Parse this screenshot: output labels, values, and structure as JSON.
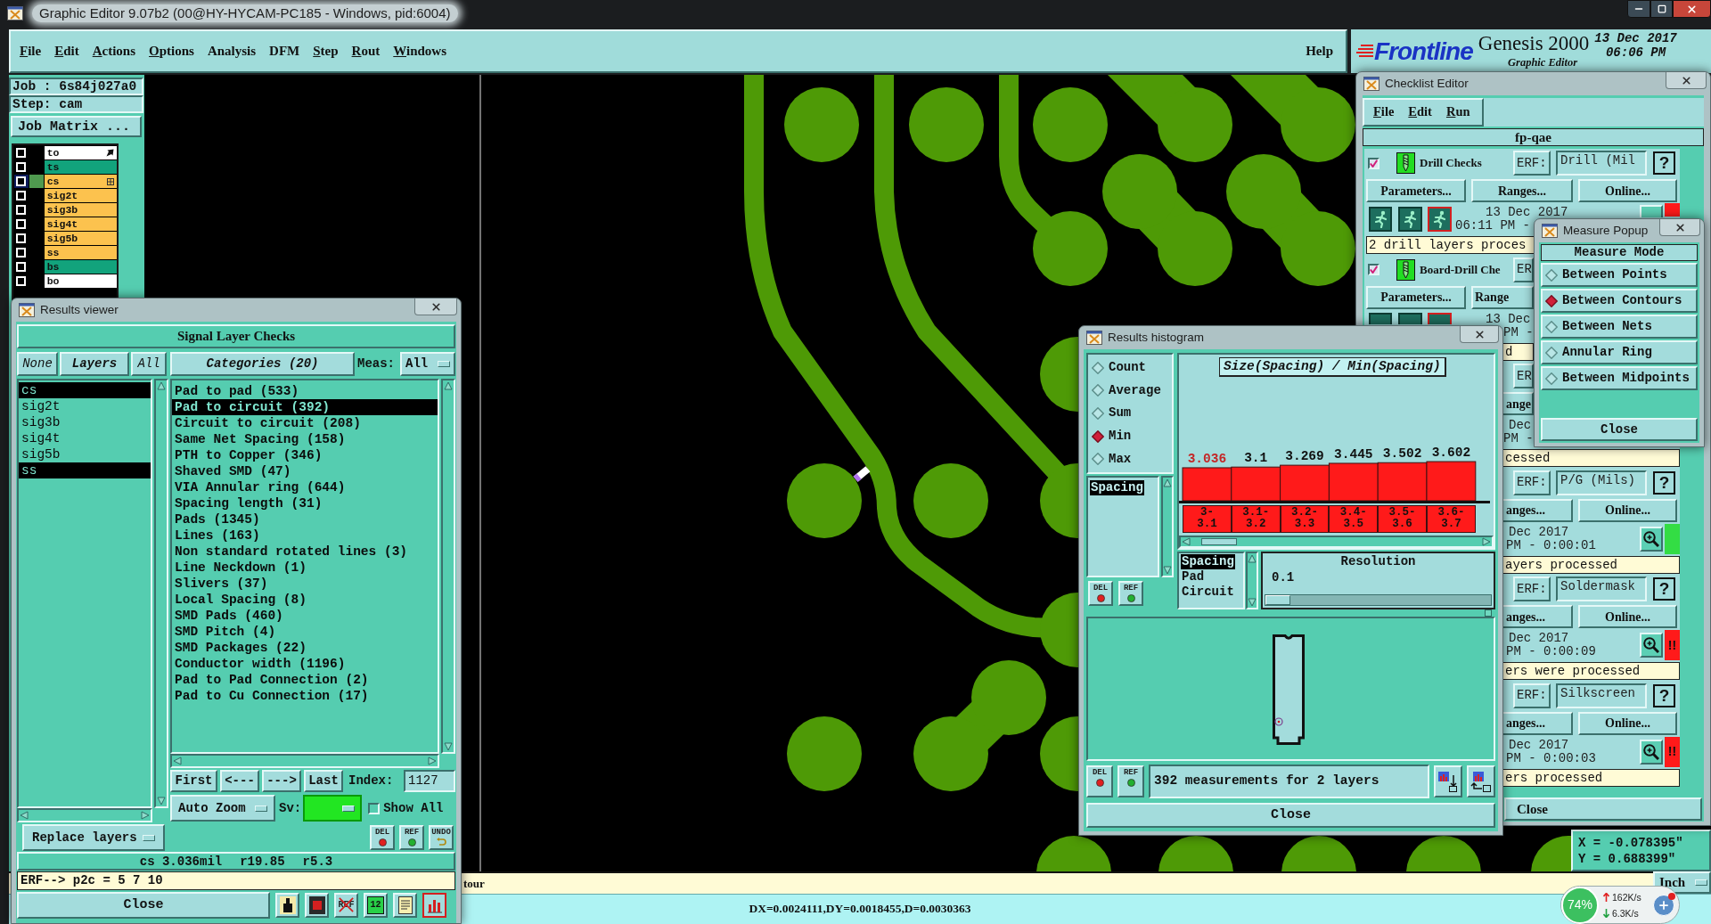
{
  "window": {
    "title": "Graphic Editor 9.07b2 (00@HY-HYCAM-PC185 - Windows, pid:6004)"
  },
  "menu": [
    {
      "label": "File",
      "mnemonic": true
    },
    {
      "label": "Edit",
      "mnemonic": true
    },
    {
      "label": "Actions",
      "mnemonic": true
    },
    {
      "label": "Options",
      "mnemonic": true
    },
    {
      "label": "Analysis",
      "mnemonic": false
    },
    {
      "label": "DFM",
      "mnemonic": false
    },
    {
      "label": "Step",
      "mnemonic": true
    },
    {
      "label": "Rout",
      "mnemonic": true
    },
    {
      "label": "Windows",
      "mnemonic": true
    }
  ],
  "help_menu": {
    "label": "Help",
    "mnemonic": false
  },
  "branding": {
    "logo": "Frontline",
    "product": "Genesis 2000",
    "subtitle": "Graphic Editor",
    "date": "13 Dec 2017",
    "time": "06:06 PM"
  },
  "job_panel": {
    "job": "Job : 6s84j027a0",
    "step": "Step: cam",
    "matrix_button": "Job Matrix ...",
    "layers": [
      {
        "name": "to",
        "color": "#ffffff",
        "checked": false,
        "selected": false,
        "kind": "pointer"
      },
      {
        "name": "ts",
        "color": "#12a37c",
        "checked": false,
        "selected": false,
        "kind": "plain"
      },
      {
        "name": "cs",
        "color": "#fcc24e",
        "checked": false,
        "selected": true,
        "kind": "grid"
      },
      {
        "name": "sig2t",
        "color": "#fcc24e",
        "checked": false,
        "selected": false,
        "kind": "plain"
      },
      {
        "name": "sig3b",
        "color": "#fcc24e",
        "checked": false,
        "selected": false,
        "kind": "plain"
      },
      {
        "name": "sig4t",
        "color": "#fcc24e",
        "checked": false,
        "selected": false,
        "kind": "plain"
      },
      {
        "name": "sig5b",
        "color": "#fcc24e",
        "checked": false,
        "selected": false,
        "kind": "plain"
      },
      {
        "name": "ss",
        "color": "#fcc24e",
        "checked": false,
        "selected": false,
        "kind": "plain"
      },
      {
        "name": "bs",
        "color": "#12a37c",
        "checked": false,
        "selected": false,
        "kind": "plain"
      },
      {
        "name": "bo",
        "color": "#ffffff",
        "checked": false,
        "selected": false,
        "kind": "plain"
      }
    ]
  },
  "cursor": {
    "x": "X = -0.078395\"",
    "y": "Y = 0.688399\""
  },
  "status_bar": {
    "message": "tour",
    "units": "Inch",
    "delta": "DX=0.0024111,DY=0.0018455,D=0.0030363"
  },
  "results_viewer": {
    "title": "Results viewer",
    "heading": "Signal Layer Checks",
    "layer_buttons": [
      {
        "label": "None",
        "bold": false
      },
      {
        "label": "Layers",
        "bold": true
      },
      {
        "label": "All",
        "bold": false
      }
    ],
    "categories_button": "Categories (20)",
    "meas_label": "Meas:",
    "meas_value": "All",
    "layers": [
      {
        "name": "cs",
        "selected": true
      },
      {
        "name": "sig2t",
        "selected": false
      },
      {
        "name": "sig3b",
        "selected": false
      },
      {
        "name": "sig4t",
        "selected": false
      },
      {
        "name": "sig5b",
        "selected": false
      },
      {
        "name": "ss",
        "selected": true
      }
    ],
    "categories": [
      {
        "label": "Pad to pad (533)",
        "selected": false
      },
      {
        "label": "Pad to circuit (392)",
        "selected": true
      },
      {
        "label": "Circuit to circuit (208)",
        "selected": false
      },
      {
        "label": "Same Net Spacing (158)",
        "selected": false
      },
      {
        "label": "PTH to Copper (346)",
        "selected": false
      },
      {
        "label": "Shaved SMD (47)",
        "selected": false
      },
      {
        "label": "VIA Annular ring (644)",
        "selected": false
      },
      {
        "label": "Spacing length (31)",
        "selected": false
      },
      {
        "label": "Pads (1345)",
        "selected": false
      },
      {
        "label": "Lines (163)",
        "selected": false
      },
      {
        "label": "Non standard rotated lines (3)",
        "selected": false
      },
      {
        "label": "Line Neckdown (1)",
        "selected": false
      },
      {
        "label": "Slivers (37)",
        "selected": false
      },
      {
        "label": "Local Spacing (8)",
        "selected": false
      },
      {
        "label": "SMD Pads (460)",
        "selected": false
      },
      {
        "label": "SMD Pitch (4)",
        "selected": false
      },
      {
        "label": "SMD Packages (22)",
        "selected": false
      },
      {
        "label": "Conductor width (1196)",
        "selected": false
      },
      {
        "label": "Pad to Pad Connection (2)",
        "selected": false
      },
      {
        "label": "Pad to Cu Connection (17)",
        "selected": false
      }
    ],
    "nav_buttons": [
      "First",
      "<---",
      "--->",
      "Last"
    ],
    "index_label": "Index:",
    "index_value": "1127",
    "zoom_mode": "Auto Zoom",
    "sv_label": "Sv:",
    "show_all": {
      "label": "Show All",
      "checked": false
    },
    "replace_mode": "Replace layers",
    "edit_buttons": [
      {
        "label": "DEL",
        "kind": "delete"
      },
      {
        "label": "REF",
        "kind": "refresh"
      },
      {
        "label": "UNDO",
        "kind": "undo"
      }
    ],
    "result_values": [
      "cs 3.036mil",
      "r19.85",
      "r5.3"
    ],
    "erf_line": "ERF--> p2c = 5 7 10",
    "close": "Close",
    "tools": [
      {
        "kind": "figure",
        "selected": false
      },
      {
        "kind": "stop",
        "selected": false
      },
      {
        "kind": "ref_off",
        "label": "REF",
        "selected": false
      },
      {
        "kind": "numbers",
        "label": "12",
        "selected": false
      },
      {
        "kind": "report",
        "selected": false
      },
      {
        "kind": "chart",
        "selected": true
      }
    ]
  },
  "checklist_editor": {
    "title": "Checklist Editor",
    "menu": [
      {
        "label": "File",
        "mnemonic": true
      },
      {
        "label": "Edit",
        "mnemonic": true
      },
      {
        "label": "Run",
        "mnemonic": true
      }
    ],
    "checklist": "fp-qae",
    "checks": [
      {
        "checked": true,
        "name": "Drill Checks",
        "erf_label": "ERF:",
        "erf_value": "Drill (Mil",
        "help": "?",
        "buttons": [
          "Parameters...",
          "Ranges...",
          "Online..."
        ],
        "date": "13 Dec 2017",
        "time": "06:11 PM -",
        "status": "2 drill layers proces",
        "indicator": {
          "color": "#ff1a1a"
        }
      },
      {
        "checked": true,
        "name": "Board-Drill Che",
        "erf_label": "ER",
        "buttons": [
          "Parameters...",
          "Range"
        ],
        "date": "13 Dec",
        "time": "PM -",
        "status": "d"
      },
      {
        "erf_label": "ER",
        "buttons": [
          "ange"
        ],
        "date": "Dec",
        "time": "PM -",
        "status": "cessed"
      },
      {
        "erf_label": "ERF:",
        "erf_value": "P/G (Mils)",
        "help": "?",
        "buttons": [
          "anges...",
          "Online..."
        ],
        "date": "Dec 2017",
        "time": "PM - 0:00:01",
        "status": "ayers processed",
        "indicator": {
          "color": "#33dd44"
        }
      },
      {
        "erf_label": "ERF:",
        "erf_value": "Soldermask",
        "help": "?",
        "buttons": [
          "anges...",
          "Online..."
        ],
        "date": "Dec 2017",
        "time": "PM - 0:00:09",
        "status": "ers were processed",
        "indicator": {
          "color": "#ff1a1a",
          "text": "!!"
        }
      },
      {
        "erf_label": "ERF:",
        "erf_value": "Silkscreen",
        "help": "?",
        "buttons": [
          "anges...",
          "Online..."
        ],
        "date": "Dec 2017",
        "time": "PM - 0:00:03",
        "status": "ers processed",
        "indicator": {
          "color": "#ff1a1a",
          "text": "!!"
        }
      }
    ],
    "close": "Close"
  },
  "histogram": {
    "title": "Results histogram",
    "modes": [
      {
        "label": "Count",
        "selected": false
      },
      {
        "label": "Average",
        "selected": false
      },
      {
        "label": "Sum",
        "selected": false
      },
      {
        "label": "Min",
        "selected": true
      },
      {
        "label": "Max",
        "selected": false
      }
    ],
    "measures": [
      {
        "label": "Spacing",
        "selected": true
      }
    ],
    "chart_data": {
      "type": "bar",
      "title": "Size(Spacing) / Min(Spacing)",
      "categories": [
        "3-\n3.1",
        "3.1-\n3.2",
        "3.2-\n3.3",
        "3.4-\n3.5",
        "3.5-\n3.6",
        "3.6-\n3.7"
      ],
      "values": [
        3.036,
        3.1,
        3.269,
        3.445,
        3.502,
        3.602
      ],
      "data_labels": true
    },
    "groups": [
      {
        "label": "Spacing",
        "selected": true
      },
      {
        "label": "Pad",
        "selected": false
      },
      {
        "label": "Circuit",
        "selected": false
      }
    ],
    "resolution": {
      "label": "Resolution",
      "value": "0.1",
      "level": 0
    },
    "edit_buttons": [
      {
        "label": "DEL",
        "kind": "delete"
      },
      {
        "label": "REF",
        "kind": "refresh"
      }
    ],
    "footer_buttons": [
      {
        "label": "DEL",
        "kind": "delete"
      },
      {
        "label": "REF",
        "kind": "refresh"
      }
    ],
    "summary": "392 measurements for 2 layers",
    "close": "Close"
  },
  "measure_popup": {
    "title": "Measure Popup",
    "heading": "Measure Mode",
    "modes": [
      {
        "label": "Between Points",
        "selected": false
      },
      {
        "label": "Between Contours",
        "selected": true
      },
      {
        "label": "Between Nets",
        "selected": false
      },
      {
        "label": "Annular Ring",
        "selected": false
      },
      {
        "label": "Between Midpoints",
        "selected": false
      }
    ],
    "close": "Close"
  },
  "tray_widget": {
    "load": "74%",
    "upload": "162K/s",
    "download": "6.3K/s"
  }
}
